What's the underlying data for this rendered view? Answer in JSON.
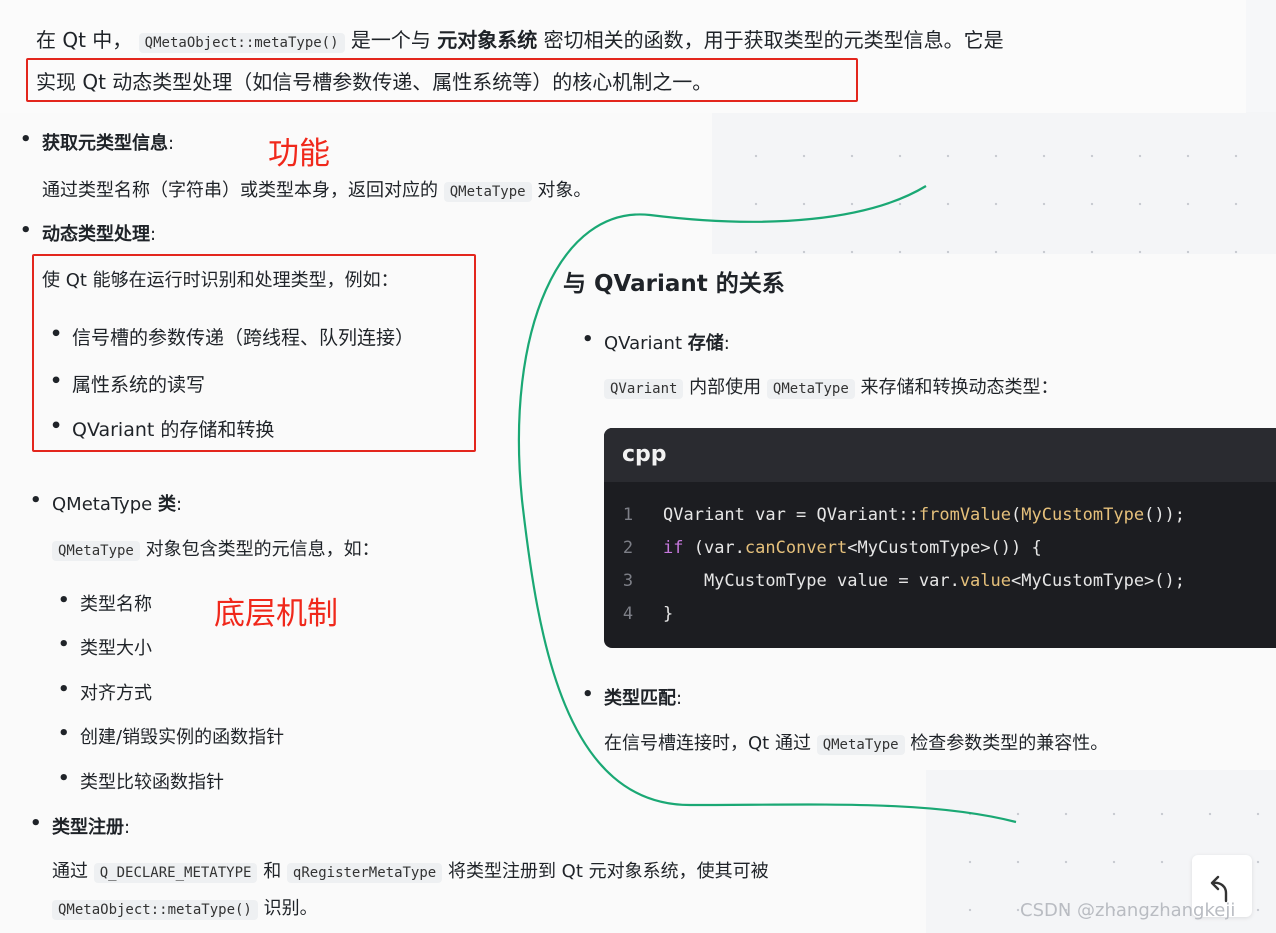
{
  "intro": {
    "line1_prefix": "在 Qt 中，",
    "line1_code": "QMetaObject::metaType()",
    "line1_mid": "是一个与",
    "line1_bold": "元对象系统",
    "line1_suffix": "密切相关的函数，用于获取类型的元类型信息。它是",
    "line2": "实现 Qt 动态类型处理（如信号槽参数传递、属性系统等）的核心机制之一。"
  },
  "section1": {
    "item1_title": "获取元类型信息",
    "item1_colon": ":",
    "item1_desc_prefix": "通过类型名称（字符串）或类型本身，返回对应的",
    "item1_desc_code": "QMetaType",
    "item1_desc_suffix": "对象。",
    "item2_title": "动态类型处理",
    "item2_colon": ":",
    "item2_desc": "使 Qt 能够在运行时识别和处理类型，例如：",
    "item2_subitems": [
      "信号槽的参数传递（跨线程、队列连接）",
      "属性系统的读写",
      "QVariant 的存储和转换"
    ]
  },
  "section2": {
    "item1_title_a": "QMetaType ",
    "item1_title_b": "类",
    "item1_colon": ":",
    "item1_desc_code": "QMetaType",
    "item1_desc_suffix": "对象包含类型的元信息，如：",
    "item1_subitems": [
      "类型名称",
      "类型大小",
      "对齐方式",
      "创建/销毁实例的函数指针",
      "类型比较函数指针"
    ],
    "item2_title": "类型注册",
    "item2_colon": ":",
    "item2_desc_prefix": "通过",
    "item2_code1": "Q_DECLARE_METATYPE",
    "item2_mid": "和",
    "item2_code2": "qRegisterMetaType",
    "item2_suffix": "将类型注册到 Qt 元对象系统，使其可被",
    "item2_code3": "QMetaObject::metaType()",
    "item2_end": "识别。"
  },
  "annotations": {
    "function": "功能",
    "mechanism": "底层机制"
  },
  "right": {
    "heading": "与 QVariant 的关系",
    "item1_title_a": "QVariant ",
    "item1_title_b": "存储",
    "item1_colon": ":",
    "item1_code1": "QVariant",
    "item1_mid": "内部使用",
    "item1_code2": "QMetaType",
    "item1_suffix": "来存储和转换动态类型：",
    "code": {
      "language": "cpp",
      "lines": [
        {
          "n": "1",
          "a": "QVariant var = QVariant::",
          "f1": "fromValue",
          "b": "(",
          "f2": "MyCustomType",
          "c": "());"
        },
        {
          "n": "2",
          "kw": "if",
          "a": " (var.",
          "f1": "canConvert",
          "b": "<MyCustomType>()) {"
        },
        {
          "n": "3",
          "a": "    MyCustomType value = var.",
          "f1": "value",
          "b": "<MyCustomType>();"
        },
        {
          "n": "4",
          "a": "}"
        }
      ]
    },
    "item2_title": "类型匹配",
    "item2_colon": ":",
    "item2_prefix": "在信号槽连接时，Qt 通过",
    "item2_code": "QMetaType",
    "item2_suffix": "检查参数类型的兼容性。"
  },
  "undo_icon": "undo-icon",
  "watermark": "CSDN @zhangzhangkeji",
  "colors": {
    "annotation_red": "#e3261d",
    "curve_green": "#1aa874",
    "code_bg": "#1c1d21"
  }
}
